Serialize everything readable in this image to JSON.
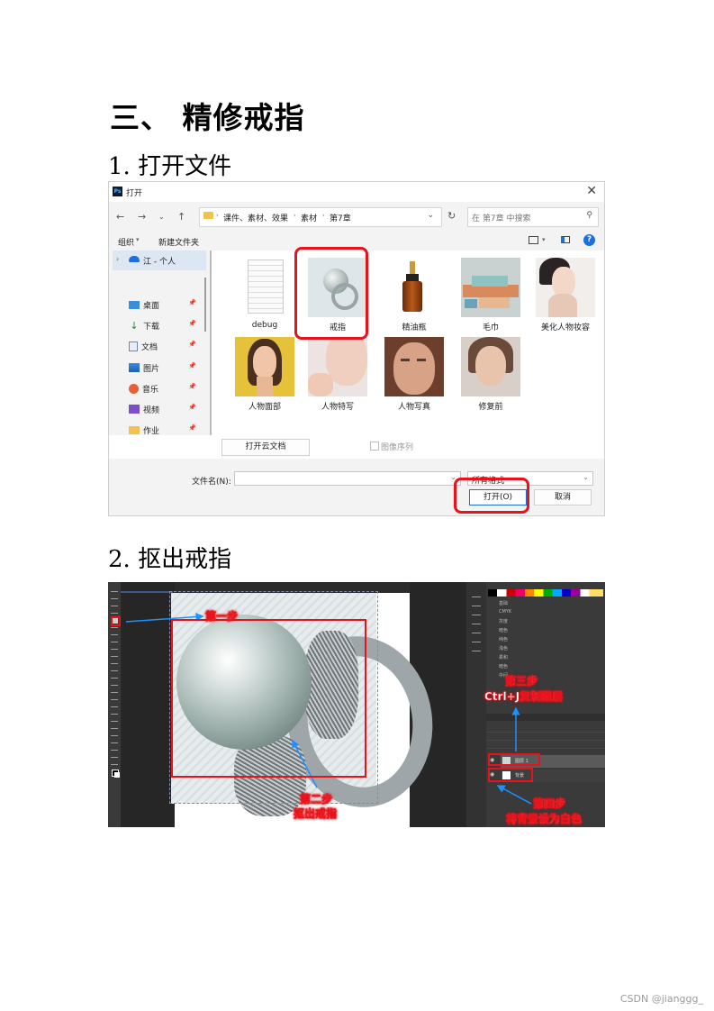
{
  "headings": {
    "main": "三、 精修戒指",
    "step1": "1. 打开文件",
    "step2": "2. 抠出戒指"
  },
  "dialog": {
    "title": "打开",
    "close_icon": "close-icon",
    "breadcrumb": [
      "课件、素材、效果",
      "素材",
      "第7章"
    ],
    "search_placeholder": "在 第7章 中搜索",
    "toolbar": {
      "organize": "组织",
      "new_folder": "新建文件夹"
    },
    "sidebar": {
      "cloud": "江 - 个人",
      "items": [
        {
          "label": "桌面",
          "icon": "desktop-icon"
        },
        {
          "label": "下载",
          "icon": "download-icon"
        },
        {
          "label": "文档",
          "icon": "document-icon"
        },
        {
          "label": "图片",
          "icon": "pictures-icon"
        },
        {
          "label": "音乐",
          "icon": "music-icon"
        },
        {
          "label": "视频",
          "icon": "video-icon"
        },
        {
          "label": "作业",
          "icon": "folder-icon"
        }
      ]
    },
    "files": [
      {
        "name": "debug"
      },
      {
        "name": "戒指"
      },
      {
        "name": "精油瓶"
      },
      {
        "name": "毛巾"
      },
      {
        "name": "美化人物妆容"
      },
      {
        "name": "人物面部"
      },
      {
        "name": "人物特写"
      },
      {
        "name": "人物写真"
      },
      {
        "name": "修复前"
      }
    ],
    "open_cloud_doc": "打开云文档",
    "image_sequence": "图像序列",
    "filename_label": "文件名(N):",
    "filename_value": "",
    "filetype_value": "所有格式",
    "open_button": "打开(O)",
    "cancel_button": "取消",
    "accent_red": "#e8121a"
  },
  "photoshop": {
    "annotations": {
      "step1": "第一步",
      "step2_line1": "第二步",
      "step2_line2": "抠出戒指",
      "step3_line1": "第三步",
      "step3_line2": "Ctrl+J复制图层",
      "step4_line1": "第四步",
      "step4_line2": "将背景设为白色"
    },
    "layers": [
      {
        "name": "图层 1"
      },
      {
        "name": "背景"
      }
    ],
    "swatch_groups": [
      "基础",
      "CMYK",
      "灰度",
      "暗色",
      "纯色",
      "浅色",
      "柔和",
      "暗色",
      "中间"
    ]
  },
  "watermark": "CSDN @jianggg_"
}
